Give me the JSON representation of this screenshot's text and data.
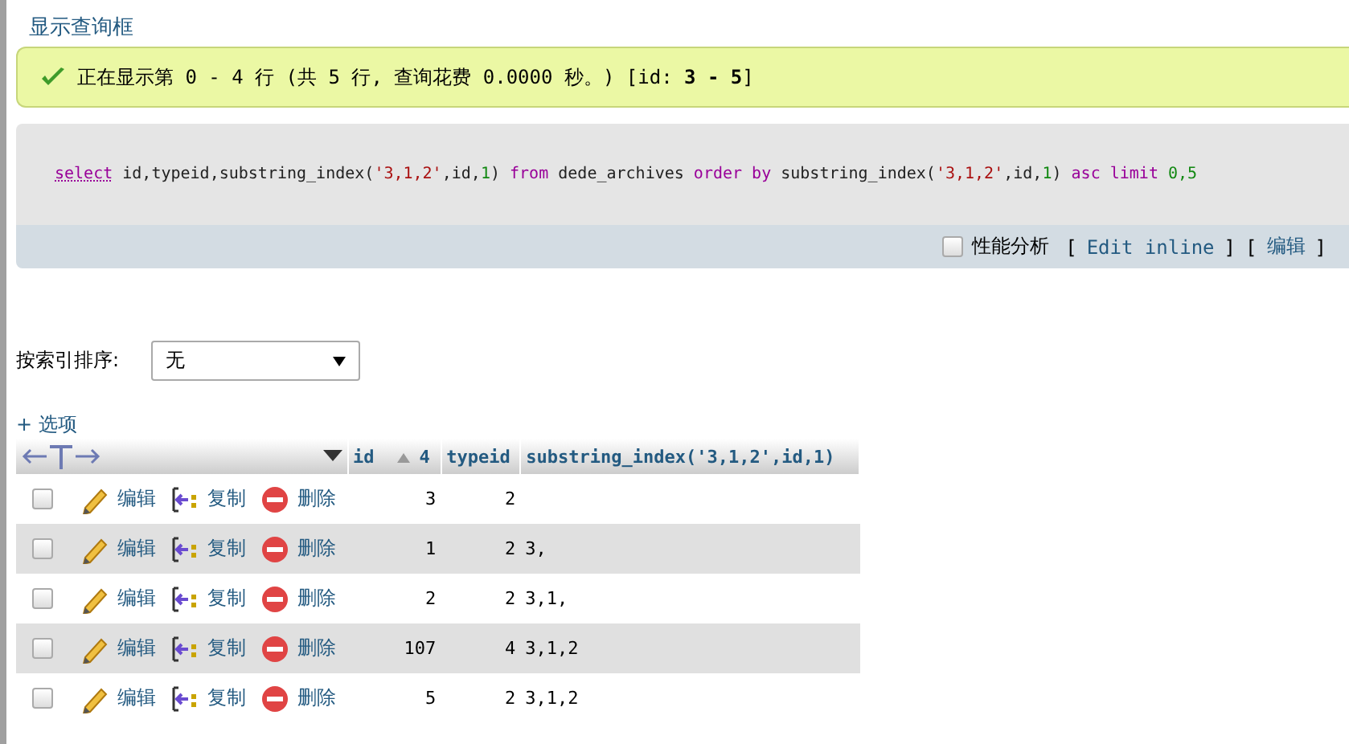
{
  "title": "显示查询框",
  "notice": {
    "kind": "success",
    "text": "正在显示第 0 - 4 行 (共 5 行, 查询花费 0.0000 秒。) [id: **3 - 5**]"
  },
  "sql": [
    {
      "kind": "keyword",
      "text": "select",
      "underline": true
    },
    {
      "kind": "plain",
      "text": " id,typeid,substring_index("
    },
    {
      "kind": "string",
      "text": "'3,1,2'"
    },
    {
      "kind": "plain",
      "text": ",id,"
    },
    {
      "kind": "number",
      "text": "1"
    },
    {
      "kind": "plain",
      "text": ") "
    },
    {
      "kind": "keyword",
      "text": "from"
    },
    {
      "kind": "plain",
      "text": " dede_archives "
    },
    {
      "kind": "keyword",
      "text": "order by"
    },
    {
      "kind": "plain",
      "text": " substring_index("
    },
    {
      "kind": "string",
      "text": "'3,1,2'"
    },
    {
      "kind": "plain",
      "text": ",id,"
    },
    {
      "kind": "number",
      "text": "1"
    },
    {
      "kind": "plain",
      "text": ") "
    },
    {
      "kind": "keyword",
      "text": "asc limit"
    },
    {
      "kind": "number",
      "text": "0,5",
      "space_before": true
    }
  ],
  "sql_footer": {
    "profiling": {
      "label": "性能分析",
      "checked": false
    },
    "links": [
      {
        "open": "[",
        "label": "Edit inline",
        "close": "]"
      },
      {
        "open": "[",
        "label": "编辑",
        "close": "]"
      }
    ]
  },
  "sort_by_key": {
    "label": "按索引排序:",
    "value": "无"
  },
  "options_link": "+ 选项",
  "table": {
    "columns": [
      {
        "label": "id",
        "sorted_ascending": true,
        "sort_badge": "4"
      },
      {
        "label": "typeid"
      },
      {
        "label": "substring_index('3,1,2',id,1)"
      }
    ],
    "rows": [
      {
        "checked": false,
        "actions": [
          "编辑",
          "复制",
          "删除"
        ],
        "cells": [
          "3",
          "2",
          ""
        ]
      },
      {
        "checked": false,
        "actions": [
          "编辑",
          "复制",
          "删除"
        ],
        "cells": [
          "1",
          "2",
          "3,"
        ]
      },
      {
        "checked": false,
        "actions": [
          "编辑",
          "复制",
          "删除"
        ],
        "cells": [
          "2",
          "2",
          "3,1,"
        ]
      },
      {
        "checked": false,
        "actions": [
          "编辑",
          "复制",
          "删除"
        ],
        "cells": [
          "107",
          "4",
          "3,1,2"
        ]
      },
      {
        "checked": false,
        "actions": [
          "编辑",
          "复制",
          "删除"
        ],
        "cells": [
          "5",
          "2",
          "3,1,2"
        ]
      }
    ]
  }
}
